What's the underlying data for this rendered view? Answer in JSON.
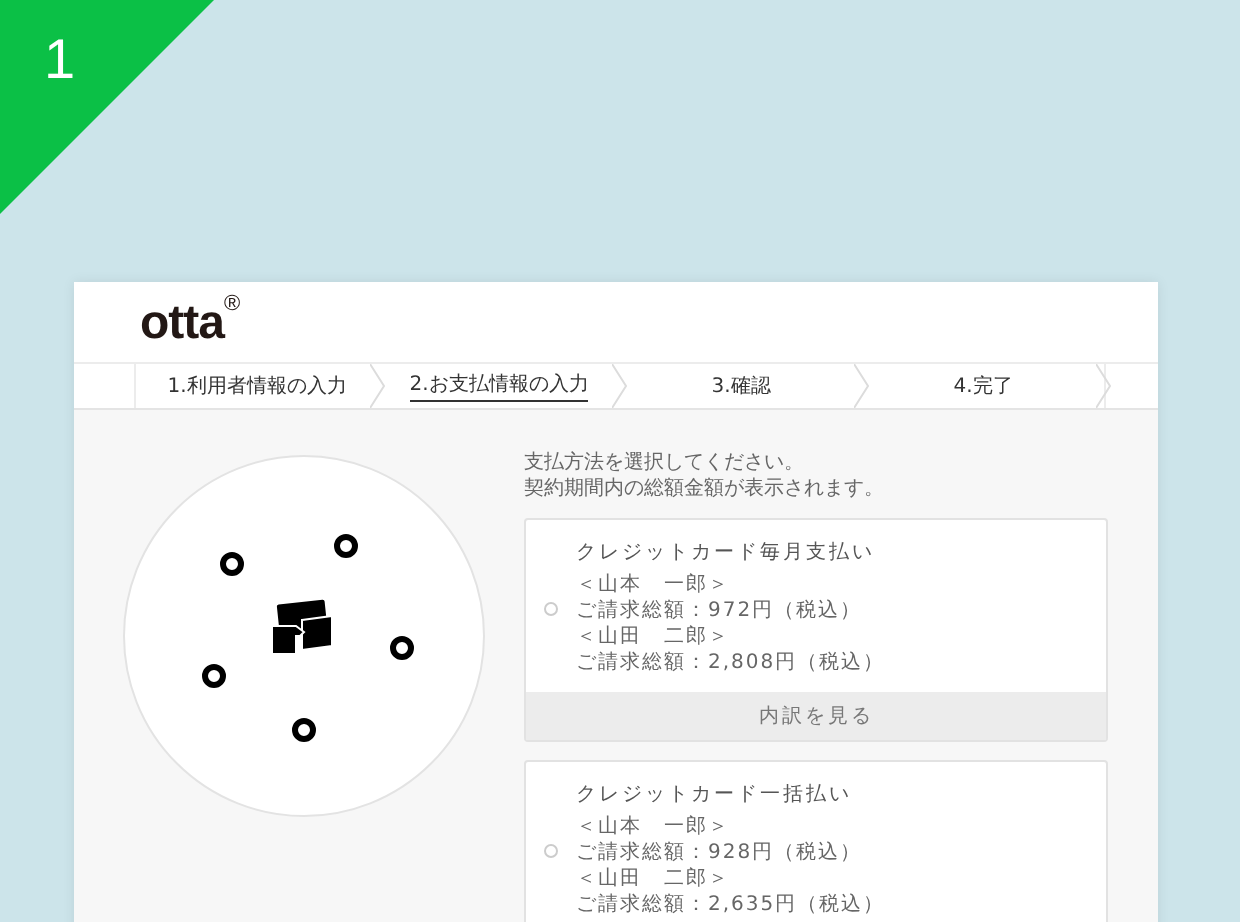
{
  "corner_badge": {
    "label": "1"
  },
  "logo": {
    "name": "otta",
    "mark": "®"
  },
  "steps": [
    {
      "label": "1.利用者情報の入力",
      "selected": false
    },
    {
      "label": "2.お支払情報の入力",
      "selected": true
    },
    {
      "label": "3.確認",
      "selected": false
    },
    {
      "label": "4.完了",
      "selected": false
    }
  ],
  "instructions": [
    "支払方法を選択してください。",
    "契約期間内の総額金額が表示されます。"
  ],
  "payment_options": [
    {
      "title": "クレジットカード毎月支払い",
      "selected": false,
      "lines": [
        "＜山本　一郎＞",
        "ご請求総額：972円（税込）",
        "＜山田　二郎＞",
        "ご請求総額：2,808円（税込）"
      ],
      "button": "内訳を見る"
    },
    {
      "title": "クレジットカード一括払い",
      "selected": false,
      "lines": [
        "＜山本　一郎＞",
        "ご請求総額：928円（税込）",
        "＜山田　二郎＞",
        "ご請求総額：2,635円（税込）"
      ]
    }
  ]
}
